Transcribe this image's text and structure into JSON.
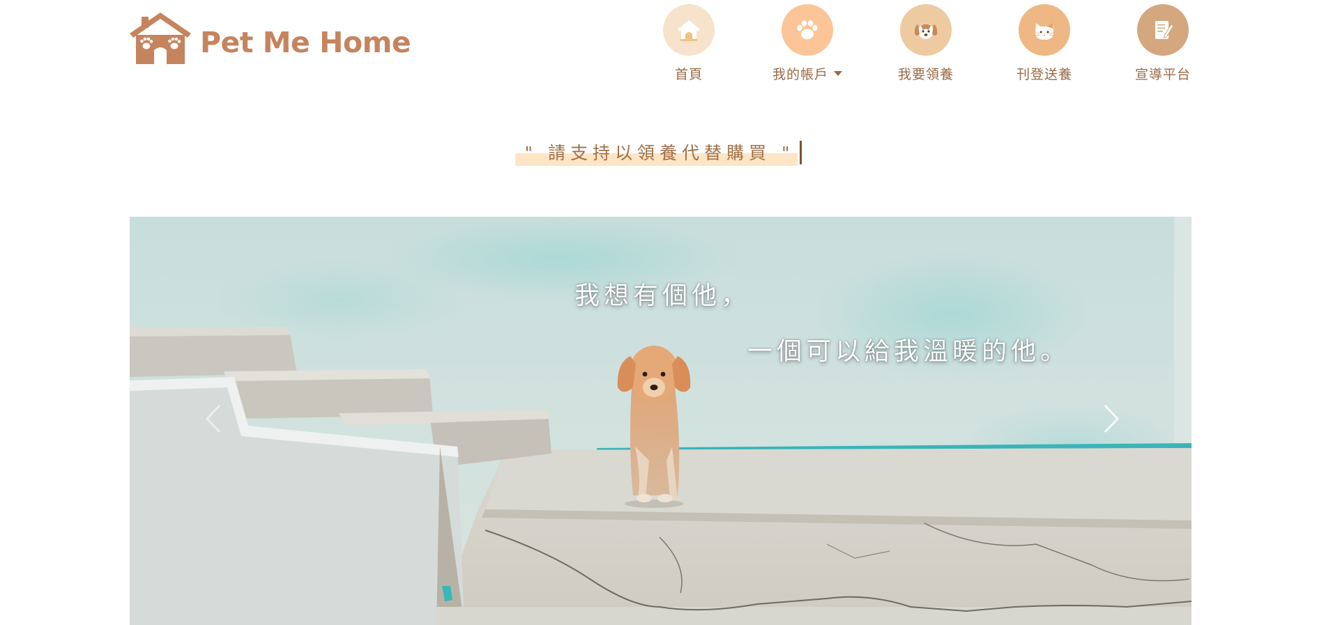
{
  "brand": {
    "name": "Pet Me Home",
    "logo_icon": "house-paws-icon",
    "color": "#c5845e"
  },
  "nav": {
    "items": [
      {
        "label": "首頁",
        "icon": "dog-house-icon",
        "circle_color": "#f7e2cc"
      },
      {
        "label": "我的帳戶",
        "icon": "paw-icon",
        "circle_color": "#fcc597",
        "has_dropdown": true,
        "dropdown_icon": "caret-down-icon"
      },
      {
        "label": "我要領養",
        "icon": "dog-face-icon",
        "circle_color": "#eecaa1"
      },
      {
        "label": "刊登送養",
        "icon": "cat-face-icon",
        "circle_color": "#efb783"
      },
      {
        "label": "宣導平台",
        "icon": "notepad-pencil-icon",
        "circle_color": "#d5a77f"
      }
    ],
    "label_color": "#9a6a45"
  },
  "slogan": {
    "text": "\" 請支持以領養代替購買 \"",
    "highlight_color": "#fde5c6",
    "text_color": "#a27149"
  },
  "carousel": {
    "caption_line_1": "我想有個他，",
    "caption_line_2": "一個可以給我溫暖的他。",
    "prev_icon": "chevron-left-icon",
    "next_icon": "chevron-right-icon",
    "image_subject": "puppy-on-concrete-steps"
  }
}
